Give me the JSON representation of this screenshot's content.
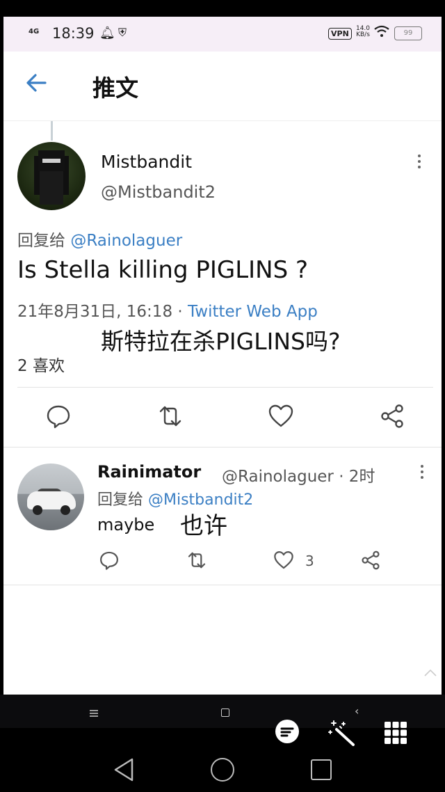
{
  "status_bar": {
    "network": "4G",
    "time": "18:39",
    "vpn": "VPN",
    "speed_value": "14.0",
    "speed_unit": "KB/s",
    "battery": "99"
  },
  "header": {
    "title": "推文",
    "back_icon": "arrow-left-icon"
  },
  "tweet": {
    "author_name": "Mistbandit",
    "author_handle": "@Mistbandit2",
    "replying_prefix": "回复给 ",
    "replying_to": "@Rainolaguer",
    "text": "Is Stella killing PIGLINS ?",
    "datetime": "21年8月31日, 16:18",
    "separator": " · ",
    "source_app": "Twitter Web App",
    "translation": "斯特拉在杀PIGLINS吗?",
    "likes_line": "2 喜欢",
    "actions": [
      "reply-icon",
      "retweet-icon",
      "like-icon",
      "share-icon"
    ]
  },
  "reply": {
    "author_name": "Rainimator",
    "handle_time": "@Rainolaguer · 2时",
    "replying_prefix": "回复给 ",
    "replying_to": "@Mistbandit2",
    "text": "maybe",
    "translation": "也许",
    "like_count": "3"
  },
  "colors": {
    "accent": "#3b7fc4",
    "status_bar_bg": "#f6eef7",
    "nav_bg": "#000000"
  }
}
